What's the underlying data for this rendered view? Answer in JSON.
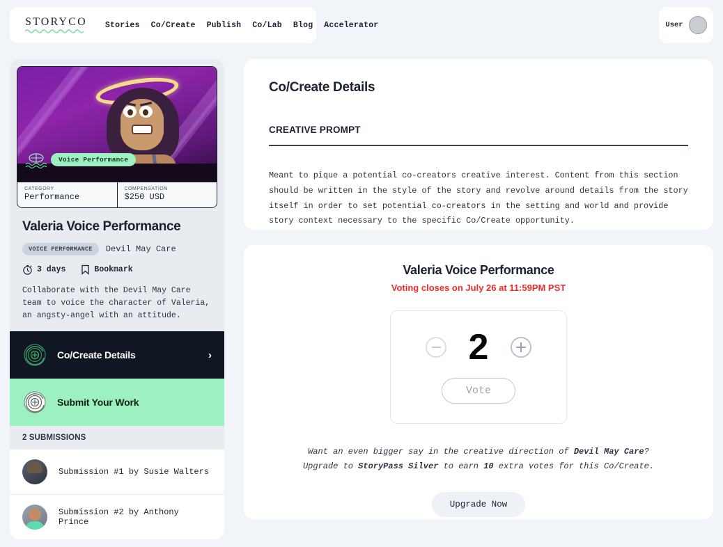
{
  "header": {
    "logo": "STORYCO",
    "nav": [
      {
        "label": "Stories"
      },
      {
        "label": "Co/Create"
      },
      {
        "label": "Publish"
      },
      {
        "label": "Co/Lab"
      },
      {
        "label": "Blog"
      },
      {
        "label": "Accelerator"
      }
    ],
    "user_label": "User"
  },
  "sidebar": {
    "card": {
      "badge": "Voice Performance",
      "category_label": "CATEGORY",
      "category_value": "Performance",
      "compensation_label": "COMPENSATION",
      "compensation_value": "$250 USD"
    },
    "title": "Valeria Voice Performance",
    "tag": "VOICE PERFORMANCE",
    "story": "Devil May Care",
    "duration": "3 days",
    "bookmark": "Bookmark",
    "description": "Collaborate with the Devil May Care team to voice the character of Valeria, an angsty-angel with an attitude.",
    "nav_items": [
      {
        "label": "Co/Create Details",
        "state": "active-dark"
      },
      {
        "label": "Submit Your Work",
        "state": "active-mint"
      }
    ],
    "submissions_header": "2 SUBMISSIONS",
    "submissions": [
      {
        "label": "Submission #1 by Susie Walters"
      },
      {
        "label": "Submission #2 by Anthony Prince"
      }
    ]
  },
  "details_panel": {
    "title": "Co/Create Details",
    "section_label": "CREATIVE PROMPT",
    "prompt": "Meant to pique a potential co-creators creative interest. Content from this section should be written in the style of the story and revolve around details from the story itself in order to set potential co-creators in the setting and world and provide story context necessary to the specific Co/Create opportunity."
  },
  "vote_panel": {
    "title": "Valeria Voice Performance",
    "deadline": "Voting closes on July 26 at 11:59PM PST",
    "count": "2",
    "vote_button": "Vote",
    "upsell_line1_pre": "Want an even bigger say in the creative direction of ",
    "upsell_line1_bold": "Devil May Care",
    "upsell_line1_post": "?",
    "upsell_line2_pre": "Upgrade to ",
    "upsell_line2_bold1": "StoryPass Silver",
    "upsell_line2_mid": " to earn ",
    "upsell_line2_bold2": "10",
    "upsell_line2_post": " extra votes for this Co/Create.",
    "upgrade_button": "Upgrade Now"
  },
  "colors": {
    "mint": "#9df0c0",
    "dark": "#111722",
    "alert_red": "#ef2b2b",
    "page_bg": "#f1f4f8"
  }
}
